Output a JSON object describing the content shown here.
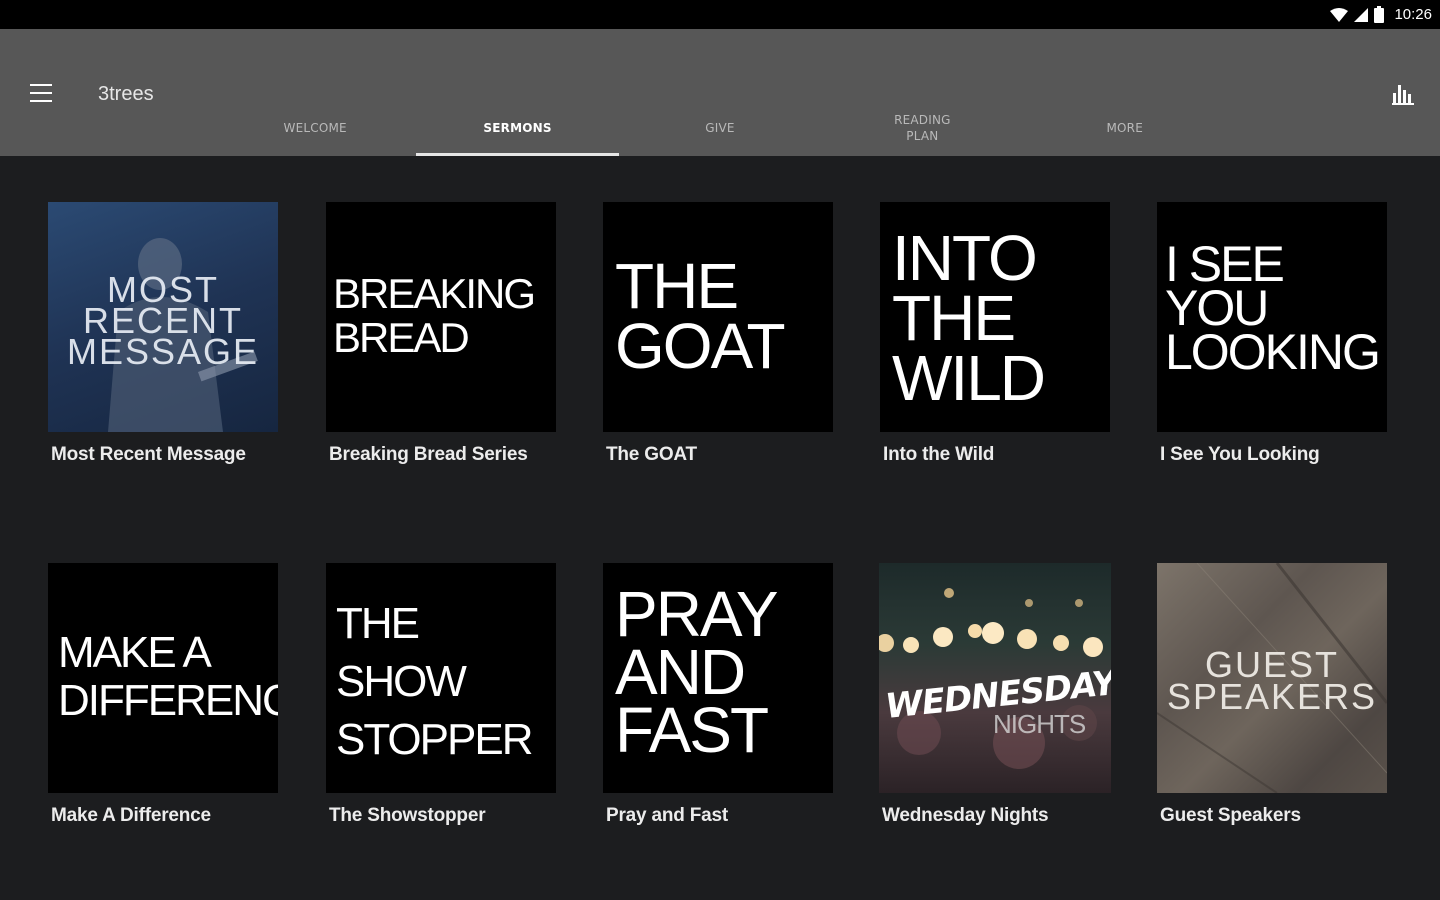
{
  "status": {
    "time": "10:26"
  },
  "appbar": {
    "title": "3trees"
  },
  "tabs": [
    {
      "label": "WELCOME",
      "active": false
    },
    {
      "label": "SERMONS",
      "active": true
    },
    {
      "label": "GIVE",
      "active": false
    },
    {
      "label": "READING\nPLAN",
      "active": false
    },
    {
      "label": "MORE",
      "active": false
    }
  ],
  "colors": {
    "statusbar": "#000000",
    "appbar": "#575757",
    "background": "#1c1d1f",
    "tile": "#000000"
  },
  "sermons": [
    {
      "caption": "Most Recent Message",
      "art_text": "MOST\nRECENT\nMESSAGE"
    },
    {
      "caption": "Breaking Bread Series",
      "art_text": "BREAKING\nBREAD"
    },
    {
      "caption": "The GOAT",
      "art_text": "THE\nGOAT"
    },
    {
      "caption": "Into the Wild",
      "art_text": "INTO\nTHE\nWILD"
    },
    {
      "caption": "I See You Looking",
      "art_text": "I SEE\nYOU\nLOOKING"
    },
    {
      "caption": "Make A Difference",
      "art_text": "MAKE A\nDIFFERENCE"
    },
    {
      "caption": "The Showstopper",
      "art_text": "THE\nSHOW\nSTOPPER"
    },
    {
      "caption": "Pray and Fast",
      "art_text": "PRAY\nAND\nFAST"
    },
    {
      "caption": "Wednesday Nights",
      "art_text": "WEDNESDAY",
      "art_subtext": "NIGHTS"
    },
    {
      "caption": "Guest Speakers",
      "art_text": "GUEST\nSPEAKERS"
    }
  ]
}
